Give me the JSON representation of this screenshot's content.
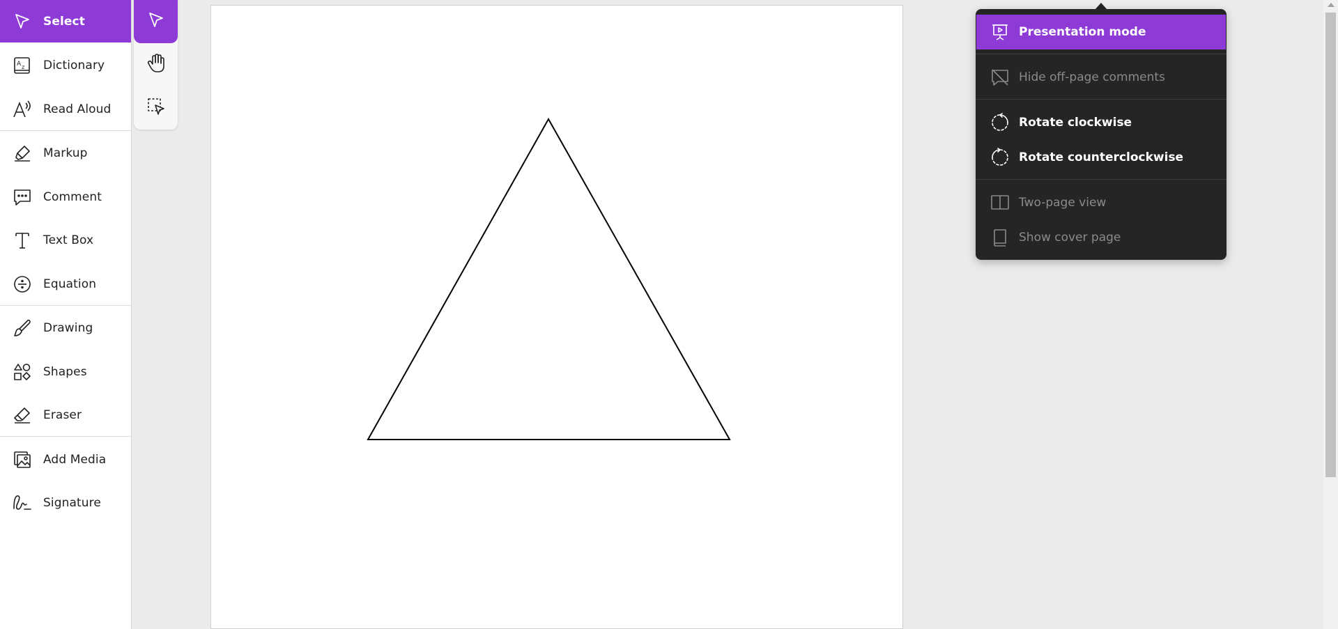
{
  "sidebar": {
    "items": [
      {
        "label": "Select",
        "icon": "cursor-arrow-icon"
      },
      {
        "label": "Dictionary",
        "icon": "dictionary-icon"
      },
      {
        "label": "Read Aloud",
        "icon": "read-aloud-icon"
      },
      {
        "label": "Markup",
        "icon": "highlighter-icon"
      },
      {
        "label": "Comment",
        "icon": "comment-icon"
      },
      {
        "label": "Text Box",
        "icon": "text-box-icon"
      },
      {
        "label": "Equation",
        "icon": "division-icon"
      },
      {
        "label": "Drawing",
        "icon": "brush-icon"
      },
      {
        "label": "Shapes",
        "icon": "shapes-icon"
      },
      {
        "label": "Eraser",
        "icon": "eraser-icon"
      },
      {
        "label": "Add Media",
        "icon": "image-icon"
      },
      {
        "label": "Signature",
        "icon": "signature-icon"
      }
    ],
    "active": "Select"
  },
  "palette": {
    "tools": [
      "cursor-arrow-icon",
      "hand-icon",
      "marquee-select-icon"
    ],
    "active": "cursor-arrow-icon"
  },
  "view_menu": {
    "items": [
      {
        "label": "Presentation mode",
        "icon": "presentation-icon",
        "state": "highlighted"
      },
      {
        "label": "Hide off-page comments",
        "icon": "hide-comments-icon",
        "state": "disabled"
      },
      {
        "label": "Rotate clockwise",
        "icon": "rotate-clockwise-icon",
        "state": "enabled"
      },
      {
        "label": "Rotate counterclockwise",
        "icon": "rotate-counterclockwise-icon",
        "state": "enabled"
      },
      {
        "label": "Two-page view",
        "icon": "two-page-icon",
        "state": "disabled"
      },
      {
        "label": "Show cover page",
        "icon": "book-icon",
        "state": "disabled"
      }
    ]
  },
  "canvas": {
    "shape": "triangle",
    "stroke": "#000000"
  },
  "colors": {
    "accent": "#8d3ad6",
    "menu_bg": "#252526",
    "menu_disabled_text": "#8a8a8c"
  }
}
